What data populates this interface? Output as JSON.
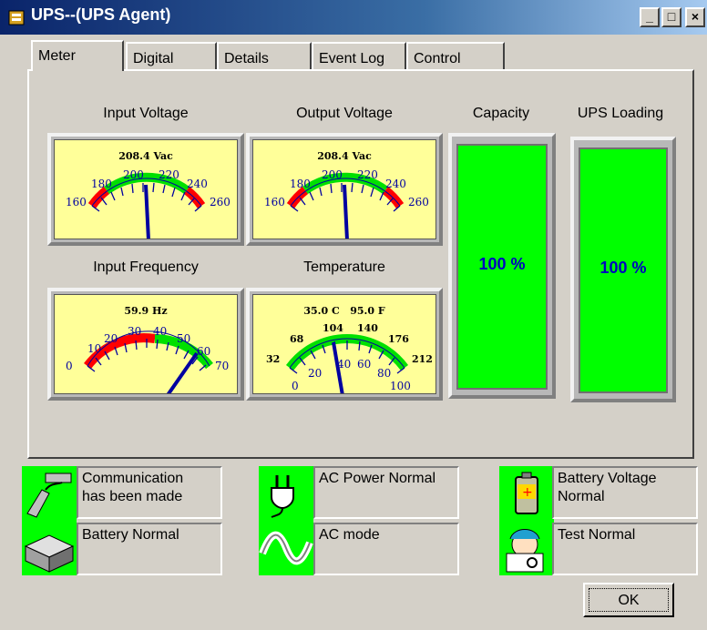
{
  "window": {
    "title": "UPS--(UPS Agent)"
  },
  "tabs": [
    {
      "label": "Meter",
      "active": true
    },
    {
      "label": "Digital",
      "active": false
    },
    {
      "label": "Details",
      "active": false
    },
    {
      "label": "Event Log",
      "active": false
    },
    {
      "label": "Control",
      "active": false
    }
  ],
  "gauges": {
    "input_voltage": {
      "label": "Input Voltage",
      "reading": "208.4 Vac",
      "ticks": [
        "160",
        "180",
        "200",
        "220",
        "240",
        "260"
      ],
      "value": 208.4,
      "min": 160,
      "max": 260
    },
    "output_voltage": {
      "label": "Output Voltage",
      "reading": "208.4 Vac",
      "ticks": [
        "160",
        "180",
        "200",
        "220",
        "240",
        "260"
      ],
      "value": 208.4,
      "min": 160,
      "max": 260
    },
    "input_frequency": {
      "label": "Input Frequency",
      "reading": "59.9 Hz",
      "ticks": [
        "0",
        "10",
        "20",
        "30",
        "40",
        "50",
        "60",
        "70"
      ],
      "value": 59.9,
      "min": 0,
      "max": 70
    },
    "temperature": {
      "label": "Temperature",
      "reading_c": "35.0 C",
      "reading_f": "95.0 F",
      "ticks_f": [
        "32",
        "68",
        "104",
        "140",
        "176",
        "212"
      ],
      "ticks_c": [
        "0",
        "20",
        "40",
        "60",
        "80",
        "100"
      ],
      "value_c": 35.0
    }
  },
  "capacity": {
    "label": "Capacity",
    "value_text": "100 %",
    "fraction": 1.0
  },
  "loading": {
    "label": "UPS Loading",
    "value_text": "100 %",
    "fraction": 1.0
  },
  "status": {
    "communication": {
      "text1": "Communication",
      "text2": "has been made",
      "icon": "serial-cable-icon"
    },
    "ac_power": {
      "text": "AC Power Normal",
      "icon": "power-plug-icon"
    },
    "battery_voltage": {
      "text1": "Battery Voltage",
      "text2": "Normal",
      "icon": "battery-icon"
    },
    "battery": {
      "text": "Battery Normal",
      "icon": "battery-pack-icon"
    },
    "ac_mode": {
      "text": "AC mode",
      "icon": "sine-wave-icon"
    },
    "test": {
      "text": "Test Normal",
      "icon": "doctor-icon"
    }
  },
  "ok_label": "OK",
  "colors": {
    "meter_face": "#ffff99",
    "green_zone": "#00e000",
    "red_zone": "#ff0000",
    "needle": "#0000a0",
    "bar_fill": "#00ff00",
    "bar_text": "#0000c0"
  }
}
